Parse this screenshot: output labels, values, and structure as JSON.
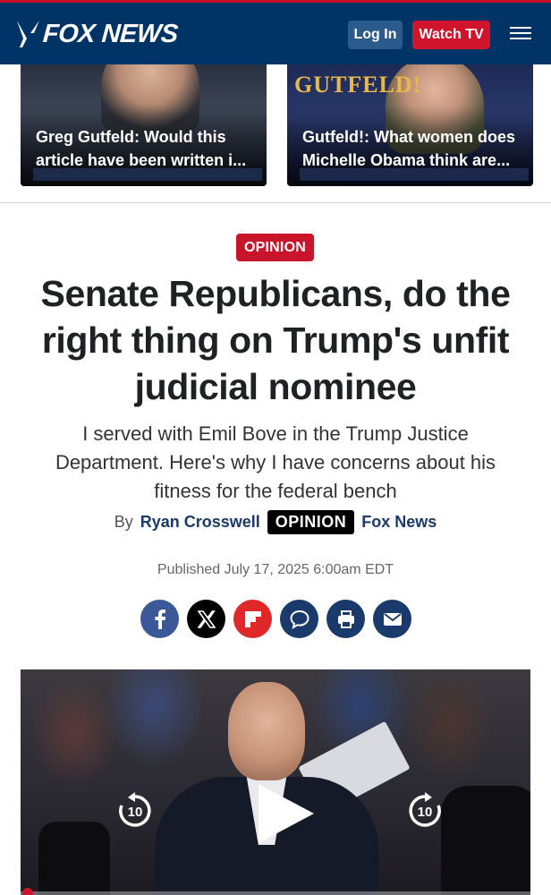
{
  "header": {
    "logo_text": "FOX NEWS",
    "login_label": "Log In",
    "watch_label": "Watch TV",
    "menu_icon": "hamburger-menu-icon",
    "brand_colors": {
      "navy": "#003366",
      "red": "#d0142b"
    }
  },
  "promos": [
    {
      "caption": "Greg Gutfeld: Would this article have been written i..."
    },
    {
      "caption": "Gutfeld!: What women does Michelle Obama think are...",
      "brand": "GUTFELD!"
    }
  ],
  "article": {
    "section_label": "OPINION",
    "headline": "Senate Republicans, do the right thing on Trump's unfit judicial nominee",
    "subhead": "I served with Emil Bove in the Trump Justice Department. Here's why I have concerns about his fitness for the federal bench",
    "byline_prefix": "By",
    "author": "Ryan Crosswell",
    "byline_tag": "OPINION",
    "byline_source": "Fox News",
    "published": "Published July 17, 2025 6:00am EDT"
  },
  "share": [
    {
      "name": "facebook-icon",
      "color": "#3b5998"
    },
    {
      "name": "x-icon",
      "color": "#000000"
    },
    {
      "name": "flipboard-icon",
      "color": "#e12828"
    },
    {
      "name": "comment-icon",
      "color": "#1a3a6b"
    },
    {
      "name": "print-icon",
      "color": "#1a3a6b"
    },
    {
      "name": "email-icon",
      "color": "#1a3a6b"
    }
  ],
  "video": {
    "rewind_seconds": "10",
    "forward_seconds": "10",
    "progress": 0
  }
}
